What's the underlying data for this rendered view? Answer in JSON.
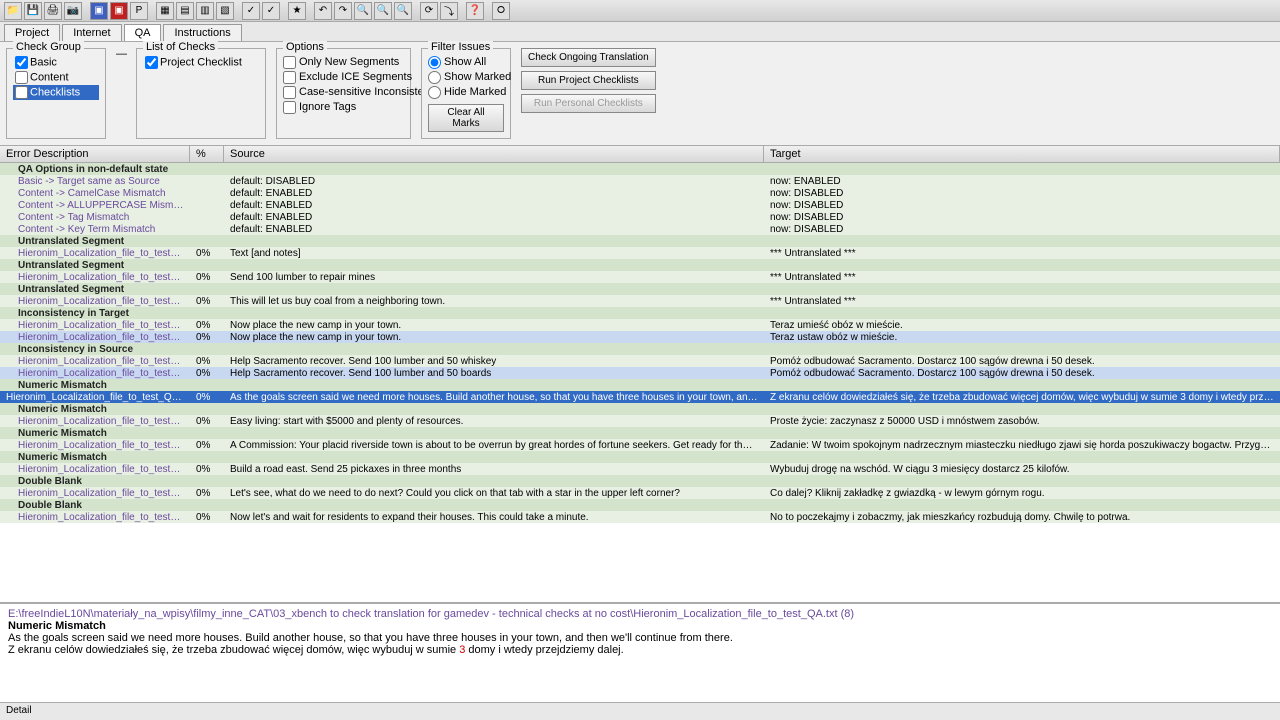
{
  "toolbar_icons": [
    "📁",
    "💾",
    "🖨",
    "📷",
    "📋",
    "🔴",
    "⬛",
    "📊",
    "📈",
    "⬜",
    "⬜",
    "✓",
    "✓",
    "⭐",
    "↶",
    "↷",
    "🔍",
    "🔍",
    "🔍",
    "⟳",
    "↻",
    "⤵",
    "❓",
    "⭘"
  ],
  "tabs": [
    "Project",
    "Internet",
    "QA",
    "Instructions"
  ],
  "active_tab": 2,
  "check_group": {
    "title": "Check Group",
    "items": [
      {
        "label": "Basic",
        "checked": true
      },
      {
        "label": "Content",
        "checked": false
      },
      {
        "label": "Checklists",
        "checked": false,
        "selected": true
      }
    ]
  },
  "list_checks": {
    "title": "List of Checks",
    "items": [
      {
        "label": "Project Checklist",
        "checked": true
      }
    ]
  },
  "options": {
    "title": "Options",
    "items": [
      {
        "label": "Only New Segments",
        "checked": false
      },
      {
        "label": "Exclude ICE Segments",
        "checked": false
      },
      {
        "label": "Case-sensitive Inconsistencies",
        "checked": false
      },
      {
        "label": "Ignore Tags",
        "checked": false
      }
    ]
  },
  "filter": {
    "title": "Filter Issues",
    "items": [
      {
        "label": "Show All",
        "checked": true
      },
      {
        "label": "Show Marked",
        "checked": false
      },
      {
        "label": "Hide Marked",
        "checked": false
      }
    ],
    "clear": "Clear All Marks"
  },
  "buttons": {
    "check": "Check Ongoing Translation",
    "project": "Run Project Checklists",
    "personal": "Run Personal Checklists"
  },
  "columns": {
    "desc": "Error Description",
    "pct": "%",
    "src": "Source",
    "tgt": "Target"
  },
  "rows": [
    {
      "type": "header",
      "desc": "QA Options in non-default state"
    },
    {
      "type": "sub",
      "desc": "Basic -> Target same as Source",
      "pct": "",
      "src": "default: DISABLED",
      "tgt": "now: ENABLED"
    },
    {
      "type": "sub",
      "desc": "Content -> CamelCase Mismatch",
      "pct": "",
      "src": "default: ENABLED",
      "tgt": "now: DISABLED"
    },
    {
      "type": "sub",
      "desc": "Content -> ALLUPPERCASE Mismatch",
      "pct": "",
      "src": "default: ENABLED",
      "tgt": "now: DISABLED"
    },
    {
      "type": "sub",
      "desc": "Content -> Tag Mismatch",
      "pct": "",
      "src": "default: ENABLED",
      "tgt": "now: DISABLED"
    },
    {
      "type": "sub",
      "desc": "Content -> Key Term Mismatch",
      "pct": "",
      "src": "default: ENABLED",
      "tgt": "now: DISABLED"
    },
    {
      "type": "header",
      "desc": "Untranslated Segment"
    },
    {
      "type": "sub",
      "desc": "Hieronim_Localization_file_to_test_QA...",
      "pct": "0%",
      "src": "Text [and notes]",
      "tgt": "*** Untranslated ***"
    },
    {
      "type": "header",
      "desc": "Untranslated Segment"
    },
    {
      "type": "sub",
      "desc": "Hieronim_Localization_file_to_test_QA...",
      "pct": "0%",
      "src": "Send 100 lumber to repair mines",
      "tgt": "*** Untranslated ***"
    },
    {
      "type": "header",
      "desc": "Untranslated Segment"
    },
    {
      "type": "sub",
      "desc": "Hieronim_Localization_file_to_test_QA...",
      "pct": "0%",
      "src": "This will let us buy coal from a neighboring town.",
      "tgt": "*** Untranslated ***"
    },
    {
      "type": "header",
      "desc": "Inconsistency in Target"
    },
    {
      "type": "sub",
      "desc": "Hieronim_Localization_file_to_test_QA...",
      "pct": "0%",
      "src": "Now place the new camp in your town.",
      "tgt": "Teraz umieść obóz w mieście."
    },
    {
      "type": "highlighted",
      "desc": "Hieronim_Localization_file_to_test_QA...",
      "pct": "0%",
      "src": "Now place the new camp in your town.",
      "tgt": "Teraz ustaw obóz w mieście."
    },
    {
      "type": "header",
      "desc": "Inconsistency in Source"
    },
    {
      "type": "sub",
      "desc": "Hieronim_Localization_file_to_test_QA...",
      "pct": "0%",
      "src": "Help Sacramento recover. Send 100 lumber and 50 whiskey",
      "tgt": "Pomóż odbudować Sacramento. Dostarcz 100 sągów drewna i 50 desek."
    },
    {
      "type": "highlighted",
      "desc": "Hieronim_Localization_file_to_test_QA...",
      "pct": "0%",
      "src": "Help Sacramento recover. Send 100 lumber and 50 boards",
      "tgt": "Pomóż odbudować Sacramento. Dostarcz 100 sągów drewna i 50 desek."
    },
    {
      "type": "header",
      "desc": "Numeric Mismatch"
    },
    {
      "type": "selected",
      "desc": "Hieronim_Localization_file_to_test_QA...",
      "pct": "0%",
      "src": "As the goals screen said we need more houses. Build another house, so that you have three houses in your town, and then we...",
      "tgt": "Z ekranu celów dowiedziałeś się, że trzeba zbudować więcej domów, więc wybuduj w sumie 3 domy i wtedy przejdziemy dal..."
    },
    {
      "type": "header",
      "desc": "Numeric Mismatch"
    },
    {
      "type": "sub",
      "desc": "Hieronim_Localization_file_to_test_QA...",
      "pct": "0%",
      "src": "Easy living: start with $5000 and plenty of resources.",
      "tgt": "Proste życie: zaczynasz z 50000 USD i mnóstwem zasobów."
    },
    {
      "type": "header",
      "desc": "Numeric Mismatch"
    },
    {
      "type": "sub",
      "desc": "Hieronim_Localization_file_to_test_QA...",
      "pct": "0%",
      "src": "A Commission: Your placid riverside town is about to be overrun by great hordes of fortune seekers. Get ready for their arrival...",
      "tgt": "Zadanie: W twoim spokojnym nadrzecznym miasteczku niedługo zjawi się horda poszukiwaczy bogactw. Przygotuj się na ic..."
    },
    {
      "type": "header",
      "desc": "Numeric Mismatch"
    },
    {
      "type": "sub",
      "desc": "Hieronim_Localization_file_to_test_QA...",
      "pct": "0%",
      "src": "Build a road east. Send 25 pickaxes in three months",
      "tgt": "Wybuduj drogę na wschód. W ciągu 3 miesięcy dostarcz 25 kilofów."
    },
    {
      "type": "header",
      "desc": "Double Blank"
    },
    {
      "type": "sub",
      "desc": "Hieronim_Localization_file_to_test_QA...",
      "pct": "0%",
      "src": "Let's see, what do we need to do next? Could you click on that tab with a star in the upper left corner?",
      "tgt": "Co dalej? Kliknij zakładkę z gwiazdką - w  lewym górnym rogu."
    },
    {
      "type": "header",
      "desc": "Double Blank"
    },
    {
      "type": "sub",
      "desc": "Hieronim_Localization_file_to_test_QA...",
      "pct": "0%",
      "src": "Now let's and wait for residents to expand their houses. This could take a minute.",
      "tgt": "No to  poczekajmy i zobaczmy, jak mieszkańcy  rozbudują domy. Chwilę to potrwa."
    }
  ],
  "detail": {
    "path": "E:\\freeIndieL10N\\materiały_na_wpisy\\filmy_inne_CAT\\03_xbench to check translation for gamedev - technical checks at no cost\\Hieronim_Localization_file_to_test_QA.txt (8)",
    "issue": "Numeric Mismatch",
    "line1": "As the goals screen said we need more houses. Build another house, so that you have three houses in your town, and then we'll continue from there.",
    "line2_a": "Z ekranu celów dowiedziałeś się, że trzeba zbudować więcej domów, więc wybuduj w sumie ",
    "line2_red": "3",
    "line2_b": " domy i wtedy przejdziemy dalej."
  },
  "status": "Detail"
}
